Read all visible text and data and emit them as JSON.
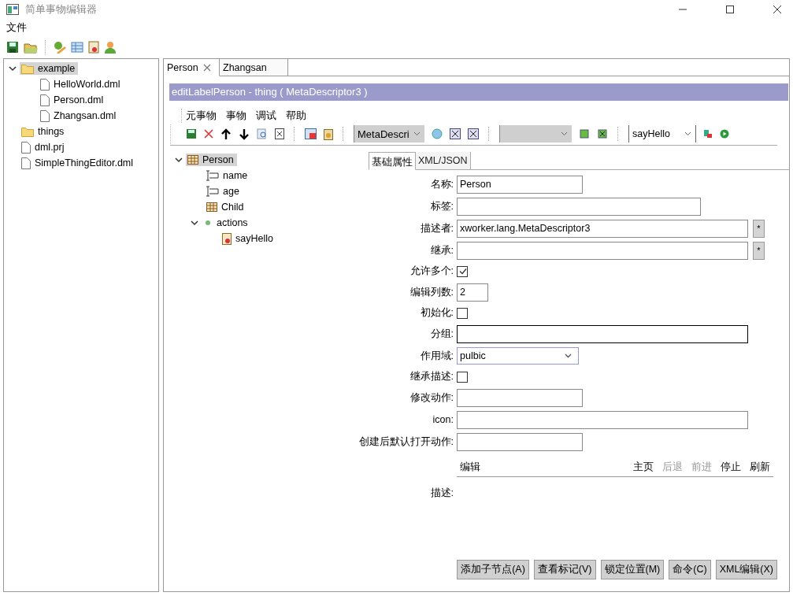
{
  "window": {
    "title": "简单事物编辑器"
  },
  "menu": [
    "文件"
  ],
  "file_tree": [
    {
      "label": "example",
      "kind": "folder",
      "expanded": true,
      "selected": true,
      "children": [
        {
          "label": "HelloWorld.dml",
          "kind": "file",
          "selected": false
        },
        {
          "label": "Person.dml",
          "kind": "file",
          "selected": false
        },
        {
          "label": "Zhangsan.dml",
          "kind": "file",
          "selected": false
        }
      ]
    },
    {
      "label": "things",
      "kind": "folder",
      "selected": false
    },
    {
      "label": "dml.prj",
      "kind": "file",
      "selected": false
    },
    {
      "label": "SimpleThingEditor.dml",
      "kind": "file",
      "selected": false
    }
  ],
  "editor_tabs": [
    {
      "label": "Person",
      "selected": true,
      "closable": true
    },
    {
      "label": "Zhangsan",
      "selected": false,
      "closable": false
    }
  ],
  "header": "editLabelPerson - thing ( MetaDescriptor3 )",
  "thing_menu": [
    "元事物",
    "事物",
    "调试",
    "帮助"
  ],
  "descriptor_combo": "MetaDescri",
  "action_combo": "sayHello",
  "thing_tree": [
    {
      "label": "Person",
      "kind": "thing",
      "expanded": true,
      "selected": true,
      "children": [
        {
          "label": "name",
          "kind": "attribute",
          "selected": false
        },
        {
          "label": "age",
          "kind": "attribute",
          "selected": false
        },
        {
          "label": "Child",
          "kind": "thing",
          "selected": false
        },
        {
          "label": "actions",
          "kind": "actions",
          "expanded": true,
          "selected": false,
          "children": [
            {
              "label": "sayHello",
              "kind": "action",
              "selected": false
            }
          ]
        }
      ]
    }
  ],
  "property_tabs": [
    {
      "label": "基础属性",
      "selected": true
    },
    {
      "label": "XML/JSON",
      "selected": false
    }
  ],
  "fields": [
    {
      "label": "名称:",
      "kind": "short",
      "value": "Person"
    },
    {
      "label": "标签:",
      "kind": "medium"
    },
    {
      "label": "描述者:",
      "kind": "lookup",
      "value": "xworker.lang.MetaDescriptor3",
      "button": "*"
    },
    {
      "label": "继承:",
      "kind": "lookup",
      "button": "*"
    },
    {
      "label": "允许多个:",
      "kind": "check",
      "checked": true
    },
    {
      "label": "编辑列数:",
      "kind": "tiny",
      "value": "2"
    },
    {
      "label": "初始化:",
      "kind": "check",
      "checked": false
    },
    {
      "label": "分组:",
      "kind": "long",
      "focused": true
    },
    {
      "label": "作用域:",
      "kind": "select",
      "value": "pulbic"
    },
    {
      "label": "继承描述:",
      "kind": "check",
      "checked": false
    },
    {
      "label": "修改动作:",
      "kind": "short"
    },
    {
      "label": "icon:",
      "kind": "long"
    },
    {
      "label": "创建后默认打开动作:",
      "kind": "short"
    }
  ],
  "editor_bar": {
    "label": "编辑",
    "links": [
      {
        "label": "主页",
        "disabled": false
      },
      {
        "label": "后退",
        "disabled": true
      },
      {
        "label": "前进",
        "disabled": true
      },
      {
        "label": "停止",
        "disabled": false
      },
      {
        "label": "刷新",
        "disabled": false
      }
    ]
  },
  "description_label": "描述:",
  "buttons": [
    "添加子节点(A)",
    "查看标记(V)",
    "锁定位置(M)",
    "命令(C)",
    "XML编辑(X)"
  ]
}
